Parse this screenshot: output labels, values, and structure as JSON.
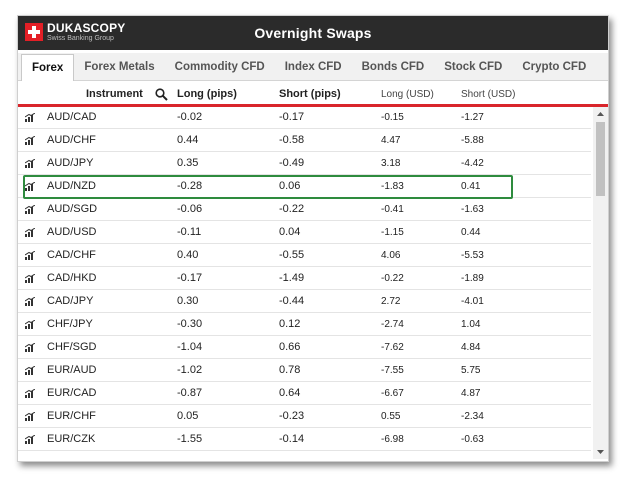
{
  "header": {
    "brand": "DUKASCOPY",
    "brand_sub": "Swiss Banking Group",
    "title": "Overnight Swaps"
  },
  "tabs": [
    {
      "label": "Forex",
      "active": true
    },
    {
      "label": "Forex Metals",
      "active": false
    },
    {
      "label": "Commodity CFD",
      "active": false
    },
    {
      "label": "Index CFD",
      "active": false
    },
    {
      "label": "Bonds CFD",
      "active": false
    },
    {
      "label": "Stock CFD",
      "active": false
    },
    {
      "label": "Crypto CFD",
      "active": false
    }
  ],
  "table": {
    "columns": {
      "instrument": "Instrument",
      "long_pips": "Long (pips)",
      "short_pips": "Short (pips)",
      "long_usd": "Long (USD)",
      "short_usd": "Short (USD)"
    },
    "rows": [
      {
        "instrument": "AUD/CAD",
        "long_pips": "-0.02",
        "short_pips": "-0.17",
        "long_usd": "-0.15",
        "short_usd": "-1.27"
      },
      {
        "instrument": "AUD/CHF",
        "long_pips": "0.44",
        "short_pips": "-0.58",
        "long_usd": "4.47",
        "short_usd": "-5.88"
      },
      {
        "instrument": "AUD/JPY",
        "long_pips": "0.35",
        "short_pips": "-0.49",
        "long_usd": "3.18",
        "short_usd": "-4.42"
      },
      {
        "instrument": "AUD/NZD",
        "long_pips": "-0.28",
        "short_pips": "0.06",
        "long_usd": "-1.83",
        "short_usd": "0.41"
      },
      {
        "instrument": "AUD/SGD",
        "long_pips": "-0.06",
        "short_pips": "-0.22",
        "long_usd": "-0.41",
        "short_usd": "-1.63"
      },
      {
        "instrument": "AUD/USD",
        "long_pips": "-0.11",
        "short_pips": "0.04",
        "long_usd": "-1.15",
        "short_usd": "0.44"
      },
      {
        "instrument": "CAD/CHF",
        "long_pips": "0.40",
        "short_pips": "-0.55",
        "long_usd": "4.06",
        "short_usd": "-5.53"
      },
      {
        "instrument": "CAD/HKD",
        "long_pips": "-0.17",
        "short_pips": "-1.49",
        "long_usd": "-0.22",
        "short_usd": "-1.89"
      },
      {
        "instrument": "CAD/JPY",
        "long_pips": "0.30",
        "short_pips": "-0.44",
        "long_usd": "2.72",
        "short_usd": "-4.01"
      },
      {
        "instrument": "CHF/JPY",
        "long_pips": "-0.30",
        "short_pips": "0.12",
        "long_usd": "-2.74",
        "short_usd": "1.04"
      },
      {
        "instrument": "CHF/SGD",
        "long_pips": "-1.04",
        "short_pips": "0.66",
        "long_usd": "-7.62",
        "short_usd": "4.84"
      },
      {
        "instrument": "EUR/AUD",
        "long_pips": "-1.02",
        "short_pips": "0.78",
        "long_usd": "-7.55",
        "short_usd": "5.75"
      },
      {
        "instrument": "EUR/CAD",
        "long_pips": "-0.87",
        "short_pips": "0.64",
        "long_usd": "-6.67",
        "short_usd": "4.87"
      },
      {
        "instrument": "EUR/CHF",
        "long_pips": "0.05",
        "short_pips": "-0.23",
        "long_usd": "0.55",
        "short_usd": "-2.34"
      },
      {
        "instrument": "EUR/CZK",
        "long_pips": "-1.55",
        "short_pips": "-0.14",
        "long_usd": "-6.98",
        "short_usd": "-0.63"
      }
    ]
  },
  "colors": {
    "header_bg": "#2b2b2b",
    "brand_red": "#e31f26",
    "divider_red": "#d9252b",
    "highlight_green": "#2e8b3e"
  },
  "icons": {
    "row_icon": "chart-icon",
    "search": "search-icon"
  }
}
